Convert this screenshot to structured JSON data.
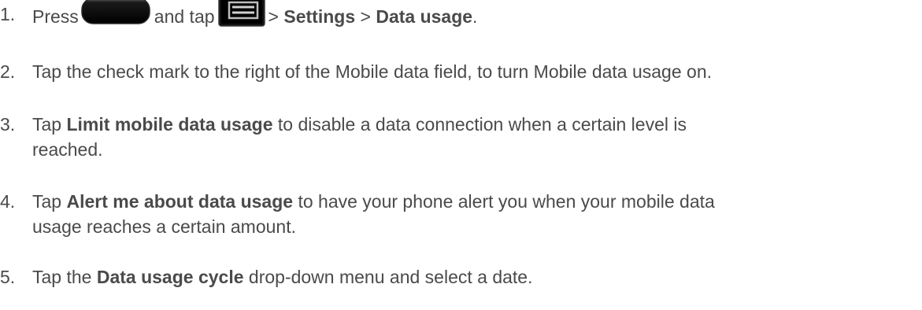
{
  "steps": [
    {
      "num": "1.",
      "press": "Press",
      "and_tap": "and tap",
      "sep1": ">",
      "settings": "Settings",
      "sep2": ">",
      "data_usage": "Data usage",
      "period": ".",
      "icons": [
        "home-key-icon",
        "menu-key-icon"
      ]
    },
    {
      "num": "2.",
      "text": "Tap the check mark to the right of the Mobile data field, to turn Mobile data usage on."
    },
    {
      "num": "3.",
      "pre": "Tap",
      "bold": "Limit mobile data usage",
      "post_line1": "to disable a data connection when a certain level is",
      "post_line2": "reached."
    },
    {
      "num": "4.",
      "pre": "Tap",
      "bold": "Alert me about data usage",
      "post_line1": "to have your phone alert you when your mobile data",
      "post_line2": "usage reaches a certain amount."
    },
    {
      "num": "5.",
      "pre": "Tap the",
      "bold": "Data usage cycle",
      "post": "drop-down menu and select a date."
    }
  ],
  "colors": {
    "text": "#4a4a4a",
    "icon_fill": "#0a0a0a"
  }
}
